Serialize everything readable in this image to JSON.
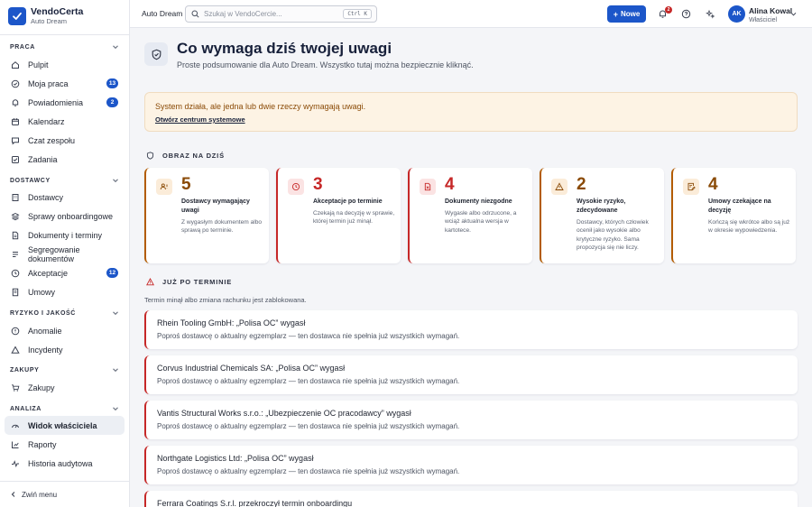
{
  "brand": {
    "name": "VendoCerta",
    "workspace": "Auto Dream"
  },
  "sidebar": {
    "sections": [
      {
        "label": "PRACA",
        "items": [
          {
            "label": "Pulpit",
            "icon": "home-icon"
          },
          {
            "label": "Moja praca",
            "icon": "check-circle-icon",
            "badge": "13"
          },
          {
            "label": "Powiadomienia",
            "icon": "bell-icon",
            "badge": "2"
          },
          {
            "label": "Kalendarz",
            "icon": "calendar-icon"
          },
          {
            "label": "Czat zespołu",
            "icon": "chat-icon"
          },
          {
            "label": "Zadania",
            "icon": "checklist-icon"
          }
        ]
      },
      {
        "label": "DOSTAWCY",
        "items": [
          {
            "label": "Dostawcy",
            "icon": "building-icon"
          },
          {
            "label": "Sprawy onboardingowe",
            "icon": "layers-icon"
          },
          {
            "label": "Dokumenty i terminy",
            "icon": "document-icon"
          },
          {
            "label": "Segregowanie dokumentów",
            "icon": "sort-icon"
          },
          {
            "label": "Akceptacje",
            "icon": "clock-icon",
            "badge": "12"
          },
          {
            "label": "Umowy",
            "icon": "contract-icon"
          }
        ]
      },
      {
        "label": "RYZYKO I JAKOŚĆ",
        "items": [
          {
            "label": "Anomalie",
            "icon": "alert-circle-icon"
          },
          {
            "label": "Incydenty",
            "icon": "triangle-icon"
          }
        ]
      },
      {
        "label": "ZAKUPY",
        "items": [
          {
            "label": "Zakupy",
            "icon": "cart-icon"
          }
        ]
      },
      {
        "label": "ANALIZA",
        "items": [
          {
            "label": "Widok właściciela",
            "icon": "gauge-icon",
            "active": true
          },
          {
            "label": "Raporty",
            "icon": "chart-icon"
          },
          {
            "label": "Historia audytowa",
            "icon": "activity-icon"
          }
        ]
      }
    ],
    "collapse_label": "Zwiń menu"
  },
  "topbar": {
    "workspace": "Auto Dream",
    "search_placeholder": "Szukaj w VendoCercie...",
    "shortcut": "Ctrl K",
    "new_label": "Nowe",
    "bell_badge": "2",
    "user": {
      "initials": "AK",
      "name": "Alina Kowal",
      "role": "Właściciel"
    }
  },
  "hero": {
    "title": "Co wymaga dziś twojej uwagi",
    "subtitle": "Proste podsumowanie dla Auto Dream. Wszystko tutaj można bezpiecznie kliknąć."
  },
  "alert": {
    "text": "System działa, ale jedna lub dwie rzeczy wymagają uwagi.",
    "link": "Otwórz centrum systemowe"
  },
  "today": {
    "label": "OBRAZ NA DZIŚ",
    "cards": [
      {
        "value": "5",
        "title": "Dostawcy wymagający uwagi",
        "desc": "Z wygasłym dokumentem albo sprawą po terminie.",
        "tone": "orange",
        "icon": "users-alert-icon"
      },
      {
        "value": "3",
        "title": "Akceptacje po terminie",
        "desc": "Czekają na decyzję w sprawie, której termin już minął.",
        "tone": "red",
        "icon": "clock-icon"
      },
      {
        "value": "4",
        "title": "Dokumenty niezgodne",
        "desc": "Wygasłe albo odrzucone, a wciąż aktualna wersja w kartotece.",
        "tone": "red",
        "icon": "doc-x-icon"
      },
      {
        "value": "2",
        "title": "Wysokie ryzyko, zdecydowane",
        "desc": "Dostawcy, których człowiek ocenił jako wysokie albo krytyczne ryzyko. Sama propozycja się nie liczy.",
        "tone": "orange",
        "icon": "warning-icon"
      },
      {
        "value": "4",
        "title": "Umowy czekające na decyzję",
        "desc": "Kończą się wkrótce albo są już w okresie wypowiedzenia.",
        "tone": "orange",
        "icon": "contract-pen-icon"
      }
    ]
  },
  "overdue": {
    "label": "JUŻ PO TERMINIE",
    "subtitle": "Termin minął albo zmiana rachunku jest zablokowana.",
    "rows": [
      {
        "title": "Rhein Tooling GmbH: „Polisa OC” wygasł",
        "desc": "Poproś dostawcę o aktualny egzemplarz — ten dostawca nie spełnia już wszystkich wymagań."
      },
      {
        "title": "Corvus Industrial Chemicals SA: „Polisa OC” wygasł",
        "desc": "Poproś dostawcę o aktualny egzemplarz — ten dostawca nie spełnia już wszystkich wymagań."
      },
      {
        "title": "Vantis Structural Works s.r.o.: „Ubezpieczenie OC pracodawcy” wygasł",
        "desc": "Poproś dostawcę o aktualny egzemplarz — ten dostawca nie spełnia już wszystkich wymagań."
      },
      {
        "title": "Northgate Logistics Ltd: „Polisa OC” wygasł",
        "desc": "Poproś dostawcę o aktualny egzemplarz — ten dostawca nie spełnia już wszystkich wymagań."
      },
      {
        "title": "Ferrara Coatings S.r.l. przekroczył termin onboardingu",
        "desc": ""
      }
    ]
  },
  "colors": {
    "accent": "#1c56c9",
    "warning": "#b35c00",
    "danger": "#c62828",
    "alert_bg": "#fdf3e4"
  }
}
